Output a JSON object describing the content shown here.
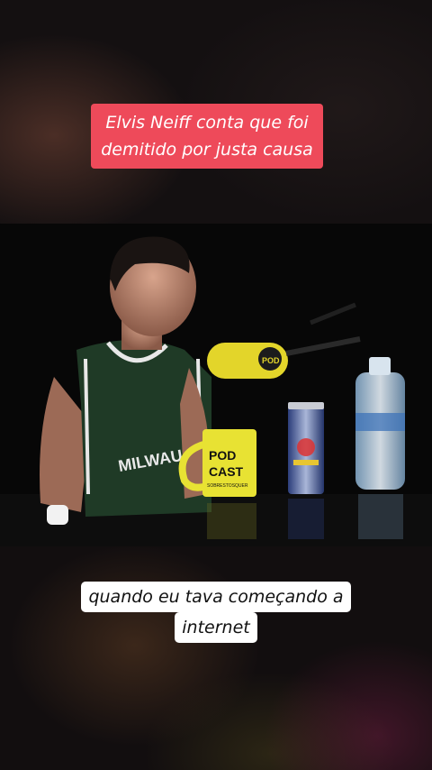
{
  "caption": {
    "line1": "Elvis Neiff conta que foi",
    "line2": "demitido por justa causa"
  },
  "video": {
    "mug_text1": "POD",
    "mug_text2": "CAST",
    "mug_text3": "SOBRESTOSQUER"
  },
  "subtitle": {
    "line1": "quando eu tava começando a",
    "line2": "internet"
  },
  "colors": {
    "caption_bg": "#ee4a5a",
    "subtitle_bg": "#ffffff",
    "mug": "#e8e233",
    "jersey": "#1f3a26"
  }
}
